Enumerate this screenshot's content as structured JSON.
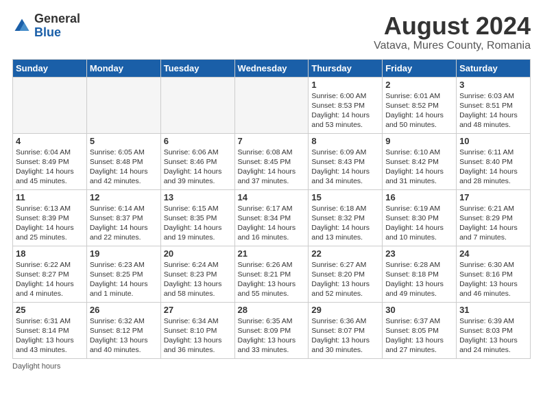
{
  "logo": {
    "general": "General",
    "blue": "Blue"
  },
  "title": "August 2024",
  "subtitle": "Vatava, Mures County, Romania",
  "days_of_week": [
    "Sunday",
    "Monday",
    "Tuesday",
    "Wednesday",
    "Thursday",
    "Friday",
    "Saturday"
  ],
  "footer": "Daylight hours",
  "weeks": [
    [
      {
        "day": "",
        "info": ""
      },
      {
        "day": "",
        "info": ""
      },
      {
        "day": "",
        "info": ""
      },
      {
        "day": "",
        "info": ""
      },
      {
        "day": "1",
        "info": "Sunrise: 6:00 AM\nSunset: 8:53 PM\nDaylight: 14 hours and 53 minutes."
      },
      {
        "day": "2",
        "info": "Sunrise: 6:01 AM\nSunset: 8:52 PM\nDaylight: 14 hours and 50 minutes."
      },
      {
        "day": "3",
        "info": "Sunrise: 6:03 AM\nSunset: 8:51 PM\nDaylight: 14 hours and 48 minutes."
      }
    ],
    [
      {
        "day": "4",
        "info": "Sunrise: 6:04 AM\nSunset: 8:49 PM\nDaylight: 14 hours and 45 minutes."
      },
      {
        "day": "5",
        "info": "Sunrise: 6:05 AM\nSunset: 8:48 PM\nDaylight: 14 hours and 42 minutes."
      },
      {
        "day": "6",
        "info": "Sunrise: 6:06 AM\nSunset: 8:46 PM\nDaylight: 14 hours and 39 minutes."
      },
      {
        "day": "7",
        "info": "Sunrise: 6:08 AM\nSunset: 8:45 PM\nDaylight: 14 hours and 37 minutes."
      },
      {
        "day": "8",
        "info": "Sunrise: 6:09 AM\nSunset: 8:43 PM\nDaylight: 14 hours and 34 minutes."
      },
      {
        "day": "9",
        "info": "Sunrise: 6:10 AM\nSunset: 8:42 PM\nDaylight: 14 hours and 31 minutes."
      },
      {
        "day": "10",
        "info": "Sunrise: 6:11 AM\nSunset: 8:40 PM\nDaylight: 14 hours and 28 minutes."
      }
    ],
    [
      {
        "day": "11",
        "info": "Sunrise: 6:13 AM\nSunset: 8:39 PM\nDaylight: 14 hours and 25 minutes."
      },
      {
        "day": "12",
        "info": "Sunrise: 6:14 AM\nSunset: 8:37 PM\nDaylight: 14 hours and 22 minutes."
      },
      {
        "day": "13",
        "info": "Sunrise: 6:15 AM\nSunset: 8:35 PM\nDaylight: 14 hours and 19 minutes."
      },
      {
        "day": "14",
        "info": "Sunrise: 6:17 AM\nSunset: 8:34 PM\nDaylight: 14 hours and 16 minutes."
      },
      {
        "day": "15",
        "info": "Sunrise: 6:18 AM\nSunset: 8:32 PM\nDaylight: 14 hours and 13 minutes."
      },
      {
        "day": "16",
        "info": "Sunrise: 6:19 AM\nSunset: 8:30 PM\nDaylight: 14 hours and 10 minutes."
      },
      {
        "day": "17",
        "info": "Sunrise: 6:21 AM\nSunset: 8:29 PM\nDaylight: 14 hours and 7 minutes."
      }
    ],
    [
      {
        "day": "18",
        "info": "Sunrise: 6:22 AM\nSunset: 8:27 PM\nDaylight: 14 hours and 4 minutes."
      },
      {
        "day": "19",
        "info": "Sunrise: 6:23 AM\nSunset: 8:25 PM\nDaylight: 14 hours and 1 minute."
      },
      {
        "day": "20",
        "info": "Sunrise: 6:24 AM\nSunset: 8:23 PM\nDaylight: 13 hours and 58 minutes."
      },
      {
        "day": "21",
        "info": "Sunrise: 6:26 AM\nSunset: 8:21 PM\nDaylight: 13 hours and 55 minutes."
      },
      {
        "day": "22",
        "info": "Sunrise: 6:27 AM\nSunset: 8:20 PM\nDaylight: 13 hours and 52 minutes."
      },
      {
        "day": "23",
        "info": "Sunrise: 6:28 AM\nSunset: 8:18 PM\nDaylight: 13 hours and 49 minutes."
      },
      {
        "day": "24",
        "info": "Sunrise: 6:30 AM\nSunset: 8:16 PM\nDaylight: 13 hours and 46 minutes."
      }
    ],
    [
      {
        "day": "25",
        "info": "Sunrise: 6:31 AM\nSunset: 8:14 PM\nDaylight: 13 hours and 43 minutes."
      },
      {
        "day": "26",
        "info": "Sunrise: 6:32 AM\nSunset: 8:12 PM\nDaylight: 13 hours and 40 minutes."
      },
      {
        "day": "27",
        "info": "Sunrise: 6:34 AM\nSunset: 8:10 PM\nDaylight: 13 hours and 36 minutes."
      },
      {
        "day": "28",
        "info": "Sunrise: 6:35 AM\nSunset: 8:09 PM\nDaylight: 13 hours and 33 minutes."
      },
      {
        "day": "29",
        "info": "Sunrise: 6:36 AM\nSunset: 8:07 PM\nDaylight: 13 hours and 30 minutes."
      },
      {
        "day": "30",
        "info": "Sunrise: 6:37 AM\nSunset: 8:05 PM\nDaylight: 13 hours and 27 minutes."
      },
      {
        "day": "31",
        "info": "Sunrise: 6:39 AM\nSunset: 8:03 PM\nDaylight: 13 hours and 24 minutes."
      }
    ]
  ]
}
